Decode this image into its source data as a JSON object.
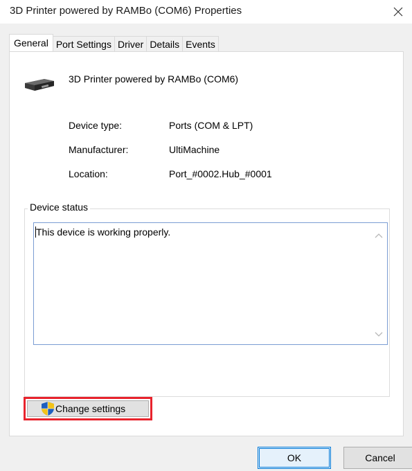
{
  "window": {
    "title": "3D Printer powered by RAMBo (COM6) Properties",
    "close_icon": "close-icon"
  },
  "tabs": [
    {
      "label": "General",
      "active": true
    },
    {
      "label": "Port Settings",
      "active": false
    },
    {
      "label": "Driver",
      "active": false
    },
    {
      "label": "Details",
      "active": false
    },
    {
      "label": "Events",
      "active": false
    }
  ],
  "device": {
    "icon": "printer-device-icon",
    "name": "3D Printer powered by RAMBo (COM6)"
  },
  "properties": [
    {
      "label": "Device type:",
      "value": "Ports (COM & LPT)"
    },
    {
      "label": "Manufacturer:",
      "value": "UltiMachine"
    },
    {
      "label": "Location:",
      "value": "Port_#0002.Hub_#0001"
    }
  ],
  "status": {
    "legend": "Device status",
    "text": "This device is working properly."
  },
  "buttons": {
    "change_settings": "Change settings",
    "ok": "OK",
    "cancel": "Cancel"
  },
  "colors": {
    "highlight_border": "#e8232c",
    "focus_blue": "#0078d7"
  }
}
